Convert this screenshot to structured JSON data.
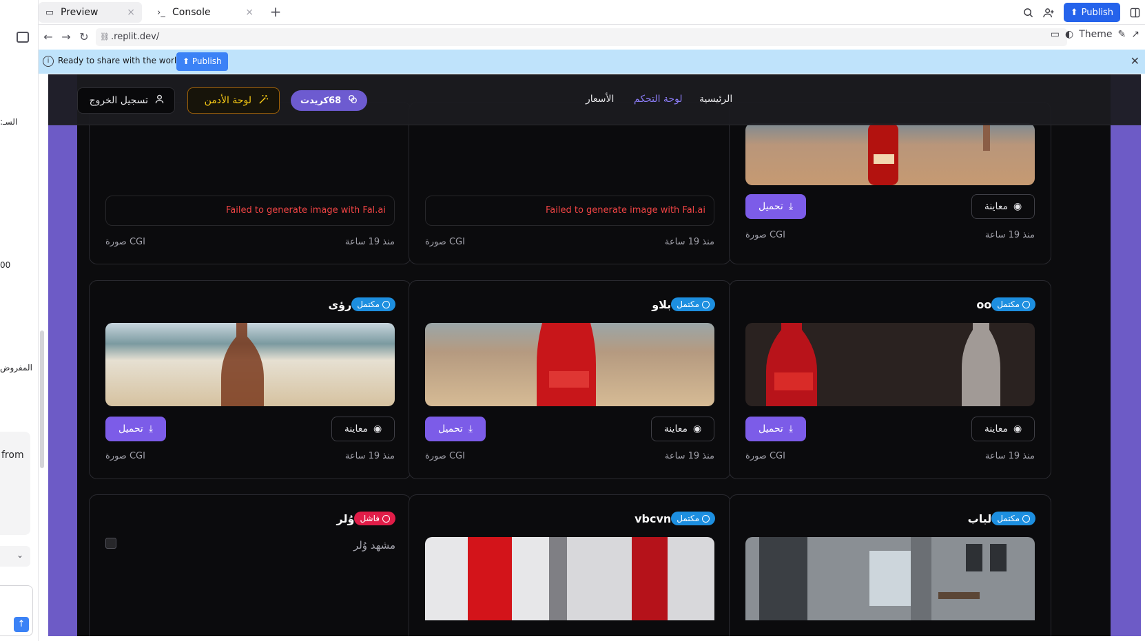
{
  "left_panel": {
    "texts": [
      ":السـ",
      "00",
      "المفروض",
      "from"
    ]
  },
  "tabs": [
    {
      "label": "Preview",
      "icon": "monitor-icon"
    },
    {
      "label": "Console",
      "icon": "terminal-icon"
    }
  ],
  "top_right": {
    "publish": "Publish"
  },
  "address": {
    "url": ".replit.dev/",
    "theme": "Theme"
  },
  "banner": {
    "text": "Ready to share with the world?",
    "publish": "Publish"
  },
  "app": {
    "header": {
      "logout": "تسجيل الخروج",
      "admin": "لوحة الأدمن",
      "credits": "68كريدت",
      "nav": [
        "الرئيسية",
        "لوحة التحكم",
        "الأسعار"
      ]
    },
    "cards": [
      {
        "error": "Failed to generate image with Fal.ai",
        "time": "منذ 19 ساعة",
        "type": "صورة CGI"
      },
      {
        "error": "Failed to generate image with Fal.ai",
        "time": "منذ 19 ساعة",
        "type": "صورة CGI"
      },
      {
        "preview": "معاينة",
        "download": "تحميل",
        "time": "منذ 19 ساعة",
        "type": "صورة CGI"
      },
      {
        "status": "مكتمل",
        "name": "رؤى",
        "preview": "معاينة",
        "download": "تحميل",
        "time": "منذ 19 ساعة",
        "type": "صورة CGI"
      },
      {
        "status": "مكتمل",
        "name": "بلاو",
        "preview": "معاينة",
        "download": "تحميل",
        "time": "منذ 19 ساعة",
        "type": "صورة CGI"
      },
      {
        "status": "مكتمل",
        "name": "oo",
        "preview": "معاينة",
        "download": "تحميل",
        "time": "منذ 19 ساعة",
        "type": "صورة CGI"
      },
      {
        "status": "فاشل",
        "name": "وُلر",
        "description": "مشهد وُلر"
      },
      {
        "status": "مكتمل",
        "name": "vbcvn"
      },
      {
        "status": "مكتمل",
        "name": "لباب"
      }
    ]
  },
  "colors": {
    "accent": "#7c5ce8",
    "badge_done": "#1d8fe0",
    "badge_fail": "#e11d48",
    "admin": "#facc15",
    "banner": "#bfe3fb"
  }
}
